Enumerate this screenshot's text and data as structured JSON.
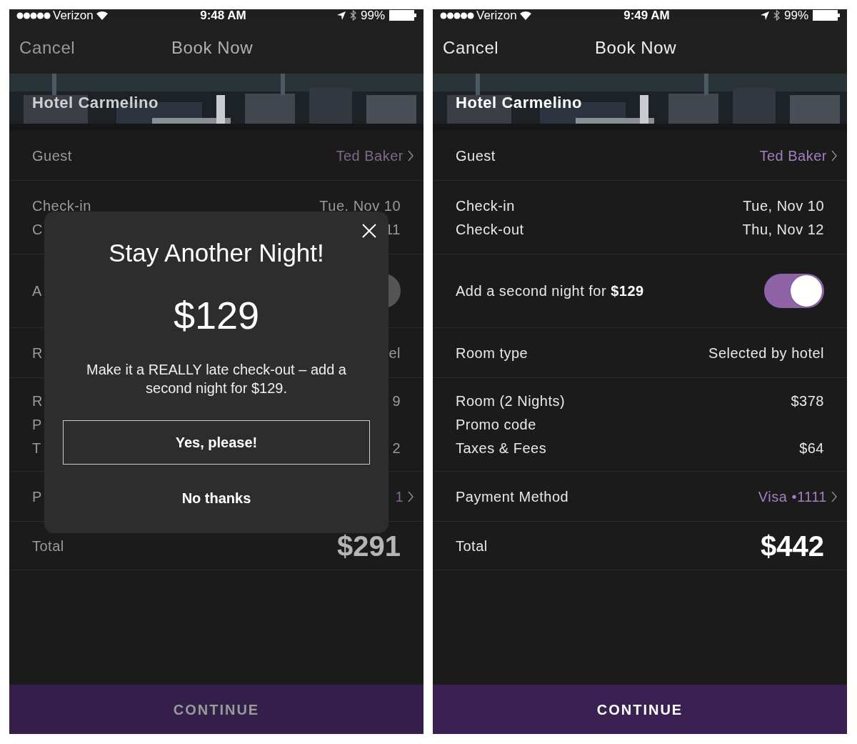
{
  "screens": [
    {
      "status_bar": {
        "carrier": "Verizon",
        "time": "9:48 AM",
        "battery": "99%"
      },
      "nav": {
        "cancel": "Cancel",
        "title": "Book Now"
      },
      "hotel": {
        "name": "Hotel Carmelino"
      },
      "dimmed": true,
      "sections": [
        {
          "kind": "lines",
          "lines": [
            {
              "label": "Guest",
              "value": "Ted Baker",
              "link": true
            }
          ]
        },
        {
          "kind": "lines",
          "lines": [
            {
              "label": "Check-in",
              "value": "Tue. Nov 10",
              "link": false
            },
            {
              "label": "C",
              "value": "11",
              "link": false
            }
          ]
        },
        {
          "kind": "toggle",
          "label": "A",
          "on": false
        },
        {
          "kind": "lines",
          "lines": [
            {
              "label": "R",
              "value": "el",
              "link": false
            }
          ]
        },
        {
          "kind": "lines",
          "lines": [
            {
              "label": "R",
              "value": "9",
              "link": false
            },
            {
              "label": "P"
            },
            {
              "label": "T",
              "value": "2",
              "link": false
            }
          ]
        },
        {
          "kind": "lines",
          "lines": [
            {
              "label": "P",
              "value": "1",
              "link": true
            }
          ]
        },
        {
          "kind": "total",
          "label": "Total",
          "value": "$291"
        }
      ],
      "modal": {
        "title": "Stay Another Night!",
        "price": "$129",
        "message": "Make it a REALLY late check-out – add a second night for $129.",
        "primary": "Yes, please!",
        "secondary": "No thanks"
      },
      "continue": "CONTINUE"
    },
    {
      "status_bar": {
        "carrier": "Verizon",
        "time": "9:49 AM",
        "battery": "99%"
      },
      "nav": {
        "cancel": "Cancel",
        "title": "Book Now"
      },
      "hotel": {
        "name": "Hotel Carmelino"
      },
      "dimmed": false,
      "sections": [
        {
          "kind": "lines",
          "lines": [
            {
              "label": "Guest",
              "value": "Ted Baker",
              "link": true
            }
          ]
        },
        {
          "kind": "lines",
          "lines": [
            {
              "label": "Check-in",
              "value": "Tue, Nov 10",
              "link": false
            },
            {
              "label": "Check-out",
              "value": "Thu, Nov 12",
              "link": false
            }
          ]
        },
        {
          "kind": "toggle",
          "label": "Add a second night for **$129**",
          "on": true
        },
        {
          "kind": "lines",
          "lines": [
            {
              "label": "Room type",
              "value": "Selected by hotel",
              "link": false
            }
          ]
        },
        {
          "kind": "lines",
          "lines": [
            {
              "label": "Room (2 Nights)",
              "value": "$378",
              "link": false
            },
            {
              "label": "Promo code"
            },
            {
              "label": "Taxes & Fees",
              "value": "$64",
              "link": false
            }
          ]
        },
        {
          "kind": "lines",
          "lines": [
            {
              "label": "Payment Method",
              "value": "Visa •1111",
              "link": true
            }
          ]
        },
        {
          "kind": "total",
          "label": "Total",
          "value": "$442"
        }
      ],
      "continue": "CONTINUE"
    }
  ]
}
